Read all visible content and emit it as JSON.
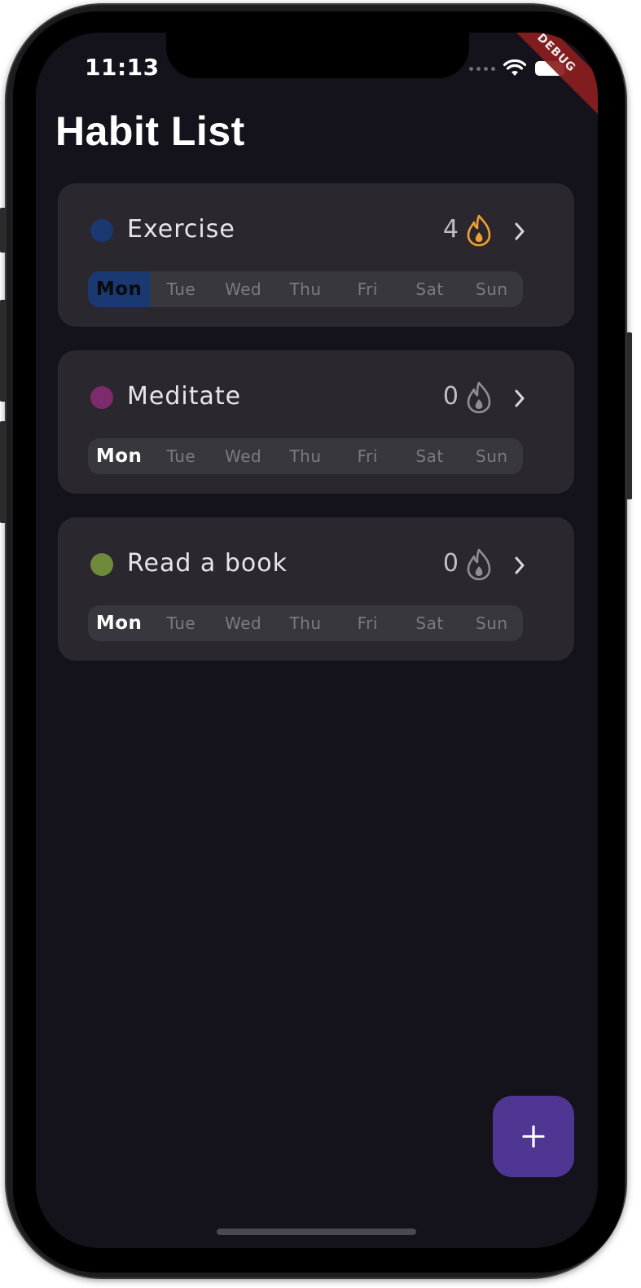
{
  "status_bar": {
    "time": "11:13"
  },
  "debug_banner": "DEBUG",
  "page": {
    "title": "Habit List"
  },
  "habits": [
    {
      "name": "Exercise",
      "color": "#1a3872",
      "streak": "4",
      "streak_active": true,
      "days": [
        "Mon",
        "Tue",
        "Wed",
        "Thu",
        "Fri",
        "Sat",
        "Sun"
      ],
      "completed_days": [
        "Mon"
      ]
    },
    {
      "name": "Meditate",
      "color": "#7e2a6e",
      "streak": "0",
      "streak_active": false,
      "days": [
        "Mon",
        "Tue",
        "Wed",
        "Thu",
        "Fri",
        "Sat",
        "Sun"
      ],
      "completed_days": []
    },
    {
      "name": "Read a book",
      "color": "#6f8a3a",
      "streak": "0",
      "streak_active": false,
      "days": [
        "Mon",
        "Tue",
        "Wed",
        "Thu",
        "Fri",
        "Sat",
        "Sun"
      ],
      "completed_days": []
    }
  ],
  "today": "Mon",
  "colors": {
    "background": "#14121a",
    "card": "#2a282e",
    "fab": "#4f3693",
    "flame_active": "#f0a030",
    "flame_inactive": "#8e8e93"
  },
  "icons": {
    "flame": "flame-icon",
    "chevron": "chevron-right-icon",
    "add": "plus-icon"
  }
}
